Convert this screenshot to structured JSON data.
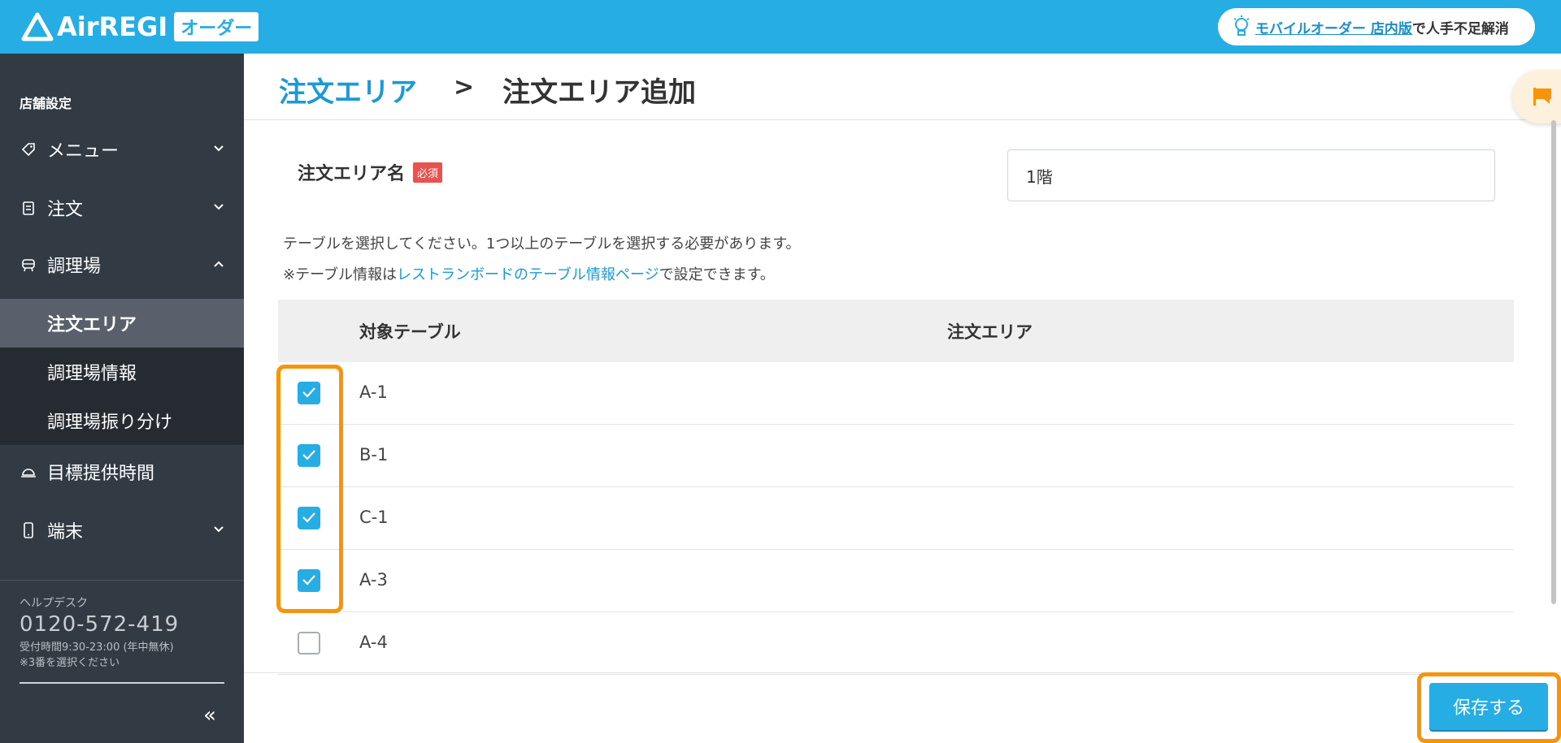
{
  "header": {
    "brand": "AirREGI",
    "brand_badge": "オーダー",
    "promo_link": "モバイルオーダー 店内版",
    "promo_text": "で人手不足解消"
  },
  "sidebar": {
    "section_title": "店舗設定",
    "items": [
      {
        "label": "メニュー",
        "icon": "tag-icon"
      },
      {
        "label": "注文",
        "icon": "clipboard-icon"
      },
      {
        "label": "調理場",
        "icon": "kitchen-icon"
      },
      {
        "label": "目標提供時間",
        "icon": "cloche-icon"
      },
      {
        "label": "端末",
        "icon": "phone-icon"
      }
    ],
    "sub_items": [
      {
        "label": "注文エリア",
        "active": true
      },
      {
        "label": "調理場情報",
        "active": false
      },
      {
        "label": "調理場振り分け",
        "active": false
      }
    ],
    "help_label": "ヘルプデスク",
    "help_phone": "0120-572-419",
    "help_hours": "受付時間9:30-23:00 (年中無休)",
    "help_note": "※3番を選択ください",
    "collapse_icon": "«"
  },
  "page": {
    "breadcrumb_link": "注文エリア",
    "breadcrumb_sep": ">",
    "breadcrumb_current": "注文エリア追加",
    "field_label": "注文エリア名",
    "required_badge": "必須",
    "area_name_value": "1階",
    "description": "テーブルを選択してください。1つ以上のテーブルを選択する必要があります。",
    "note_prefix": "※テーブル情報は",
    "note_link": "レストランボードのテーブル情報ページ",
    "note_suffix": "で設定できます。",
    "save_label": "保存する"
  },
  "table": {
    "columns": [
      "対象テーブル",
      "注文エリア"
    ],
    "rows": [
      {
        "name": "A-1",
        "area": "",
        "checked": true
      },
      {
        "name": "B-1",
        "area": "",
        "checked": true
      },
      {
        "name": "C-1",
        "area": "",
        "checked": true
      },
      {
        "name": "A-3",
        "area": "",
        "checked": true
      },
      {
        "name": "A-4",
        "area": "",
        "checked": false
      }
    ]
  },
  "colors": {
    "brand": "#25ade4",
    "highlight": "#f7940b",
    "required": "#e8524f"
  }
}
